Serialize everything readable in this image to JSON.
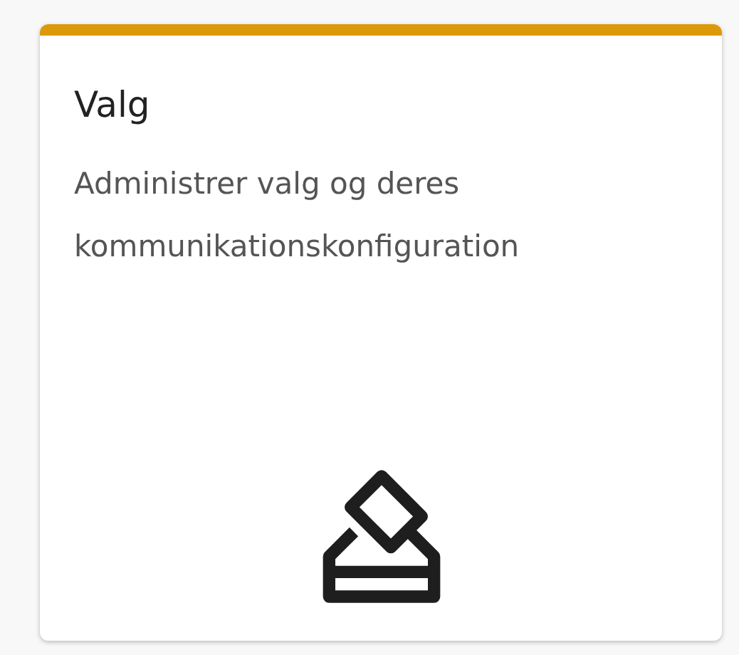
{
  "card": {
    "color": "#dc9a0a",
    "title": "Valg",
    "description": "Administrer valg og deres kommunikationskonfiguration"
  }
}
